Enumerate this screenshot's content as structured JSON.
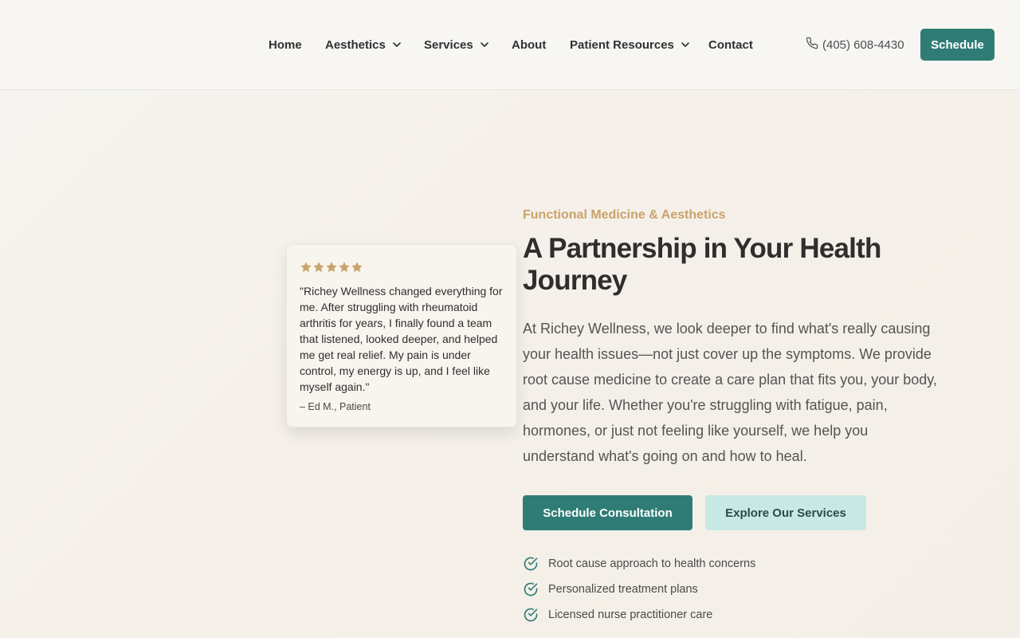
{
  "nav": {
    "items": [
      {
        "label": "Home",
        "has_dropdown": false
      },
      {
        "label": "Aesthetics",
        "has_dropdown": true
      },
      {
        "label": "Services",
        "has_dropdown": true
      },
      {
        "label": "About",
        "has_dropdown": false
      },
      {
        "label": "Patient Resources",
        "has_dropdown": true
      },
      {
        "label": "Contact",
        "has_dropdown": false
      }
    ],
    "phone": "(405) 608-4430",
    "schedule_label": "Schedule"
  },
  "testimonial": {
    "rating": 5,
    "quote": "\"Richey Wellness changed everything for me. After struggling with rheumatoid arthritis for years, I finally found a team that listened, looked deeper, and helped me get real relief. My pain is under control, my energy is up, and I feel like myself again.\"",
    "author": "– Ed M., Patient"
  },
  "hero": {
    "eyebrow": "Functional Medicine & Aesthetics",
    "headline": "A Partnership in Your Health Journey",
    "lead": "At Richey Wellness, we look deeper to find what's really causing your health issues—not just cover up the symptoms. We provide root cause medicine to create a care plan that fits you, your body, and your life. Whether you're struggling with fatigue, pain, hormones, or just not feeling like yourself, we help you understand what's going on and how to heal.",
    "primary_cta": "Schedule Consultation",
    "secondary_cta": "Explore Our Services",
    "features": [
      "Root cause approach to health concerns",
      "Personalized treatment plans",
      "Licensed nurse practitioner care"
    ]
  },
  "colors": {
    "teal": "#2f7c76",
    "teal_light": "#c8e8e4",
    "gold": "#c9a36b",
    "star": "#c9a36b"
  },
  "icons": {
    "phone": "phone-icon",
    "chevron": "chevron-down-icon",
    "star": "star-icon",
    "check": "check-circle-icon"
  }
}
